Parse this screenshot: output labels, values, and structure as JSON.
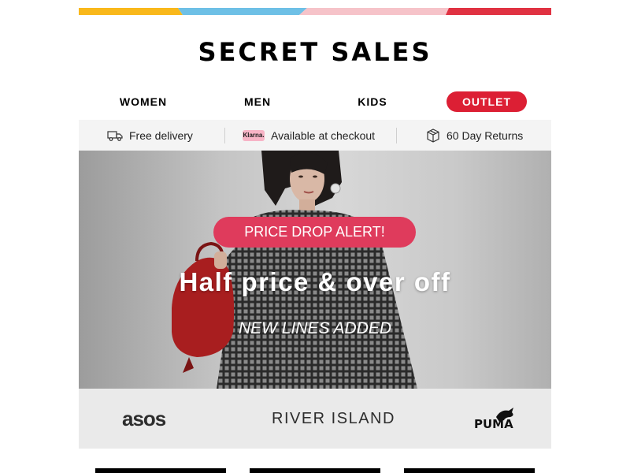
{
  "colors": {
    "strip": [
      "#f9b81b",
      "#6ec0e6",
      "#f6c3c9",
      "#e03242"
    ],
    "outlet_bg": "#dc1f34",
    "promo_pill": "#df3b5c",
    "benefits_bg": "#f4f4f4",
    "brands_bg": "#eaeaea"
  },
  "logo": {
    "text": "SECRET SALES"
  },
  "nav": {
    "women": "WOMEN",
    "men": "MEN",
    "kids": "KIDS",
    "outlet": "OUTLET"
  },
  "benefits": {
    "delivery": {
      "icon": "truck-icon",
      "label": "Free delivery"
    },
    "klarna": {
      "icon": "klarna-badge",
      "badge": "Klarna.",
      "label": "Available at checkout"
    },
    "returns": {
      "icon": "box-icon",
      "label": "60 Day Returns"
    }
  },
  "hero": {
    "badge": "PRICE DROP ALERT!",
    "headline": "Half price & over off",
    "subline": "NEW LINES ADDED"
  },
  "brands": {
    "asos": "asos",
    "river_island": "RIVER ISLAND",
    "puma": "PUMA"
  }
}
